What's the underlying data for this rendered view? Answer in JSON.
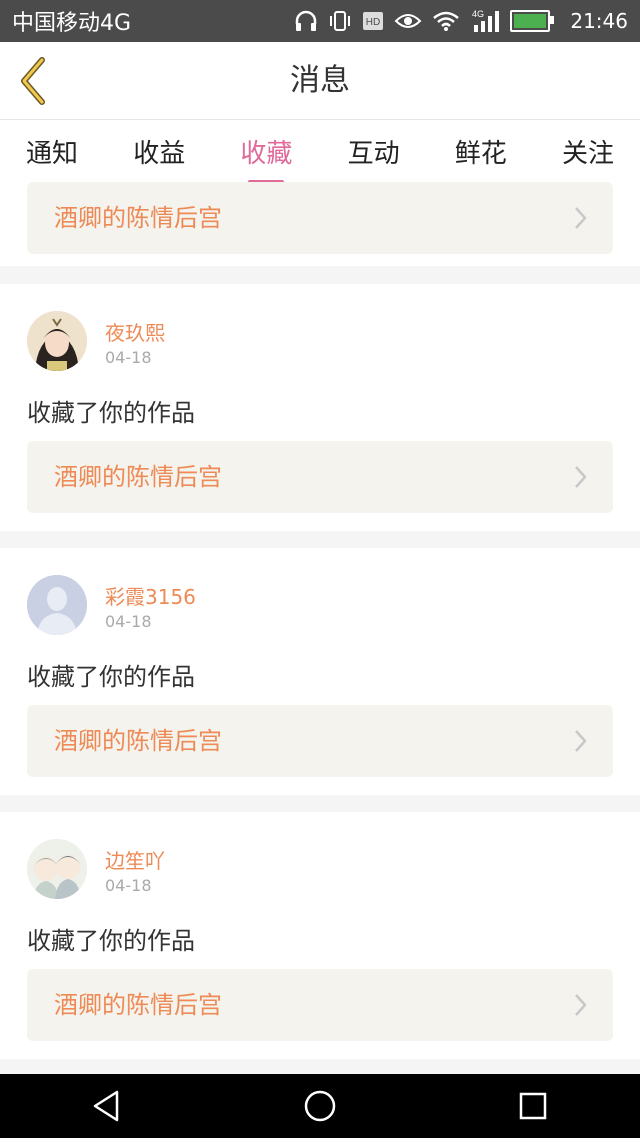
{
  "status_bar": {
    "carrier": "中国移动4G",
    "network": "4G",
    "time": "21:46",
    "icons": [
      "headphones-icon",
      "vibrate-icon",
      "hd-icon",
      "eye-icon",
      "wifi-icon",
      "signal-icon",
      "battery-icon"
    ]
  },
  "header": {
    "title": "消息"
  },
  "tabs": [
    {
      "label": "通知",
      "active": false
    },
    {
      "label": "收益",
      "active": false
    },
    {
      "label": "收藏",
      "active": true
    },
    {
      "label": "互动",
      "active": false
    },
    {
      "label": "鲜花",
      "active": false
    },
    {
      "label": "关注",
      "active": false
    }
  ],
  "top_partial_card": {
    "work_title": "酒卿的陈情后宫"
  },
  "entries": [
    {
      "username": "夜玖熙",
      "date": "04-18",
      "action": "收藏了你的作品",
      "work_title": "酒卿的陈情后宫"
    },
    {
      "username": "彩霞3156",
      "date": "04-18",
      "action": "收藏了你的作品",
      "work_title": "酒卿的陈情后宫"
    },
    {
      "username": "边笙吖",
      "date": "04-18",
      "action": "收藏了你的作品",
      "work_title": "酒卿的陈情后宫"
    }
  ],
  "colors": {
    "accent": "#e06a9a",
    "orange": "#ee8a55",
    "status_bar": "#4b4b4b"
  }
}
